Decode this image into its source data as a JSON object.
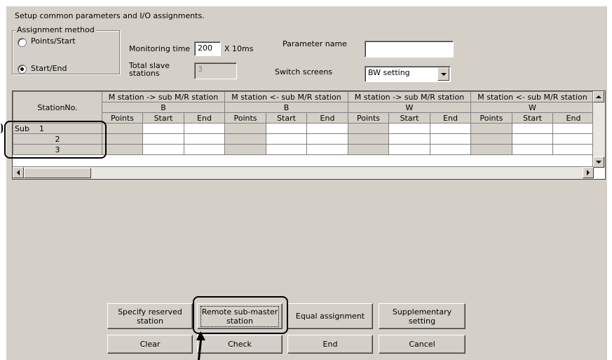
{
  "instruction": "Setup common parameters and I/O assignments.",
  "assignment_method": {
    "title": "Assignment method",
    "options": [
      "Points/Start",
      "Start/End"
    ],
    "selected": "Start/End"
  },
  "monitoring_time": {
    "label": "Monitoring time",
    "value": "200",
    "unit": "X 10ms"
  },
  "total_slave_stations": {
    "label_line1": "Total slave",
    "label_line2": "stations",
    "value": "3"
  },
  "parameter_name": {
    "label": "Parameter name",
    "value": ""
  },
  "switch_screens": {
    "label": "Switch screens",
    "value": "BW setting"
  },
  "table": {
    "station_header": "StationNo.",
    "groups": [
      {
        "label": "M station -> sub M/R station",
        "device": "B"
      },
      {
        "label": "M station <- sub M/R station",
        "device": "B"
      },
      {
        "label": "M station -> sub M/R station",
        "device": "W"
      },
      {
        "label": "M station <- sub M/R station",
        "device": "W"
      }
    ],
    "subcolumns": [
      "Points",
      "Start",
      "End"
    ],
    "rows": [
      {
        "station": "Sub    1"
      },
      {
        "station": "2"
      },
      {
        "station": "3"
      }
    ]
  },
  "buttons": {
    "specify_reserved_line1": "Specify reserved",
    "specify_reserved_line2": "station",
    "remote_submaster_line1": "Remote sub-master",
    "remote_submaster_line2": "station",
    "equal_assignment": "Equal assignment",
    "supplementary_line1": "Supplementary",
    "supplementary_line2": "setting",
    "clear": "Clear",
    "check": "Check",
    "end": "End",
    "cancel": "Cancel"
  }
}
